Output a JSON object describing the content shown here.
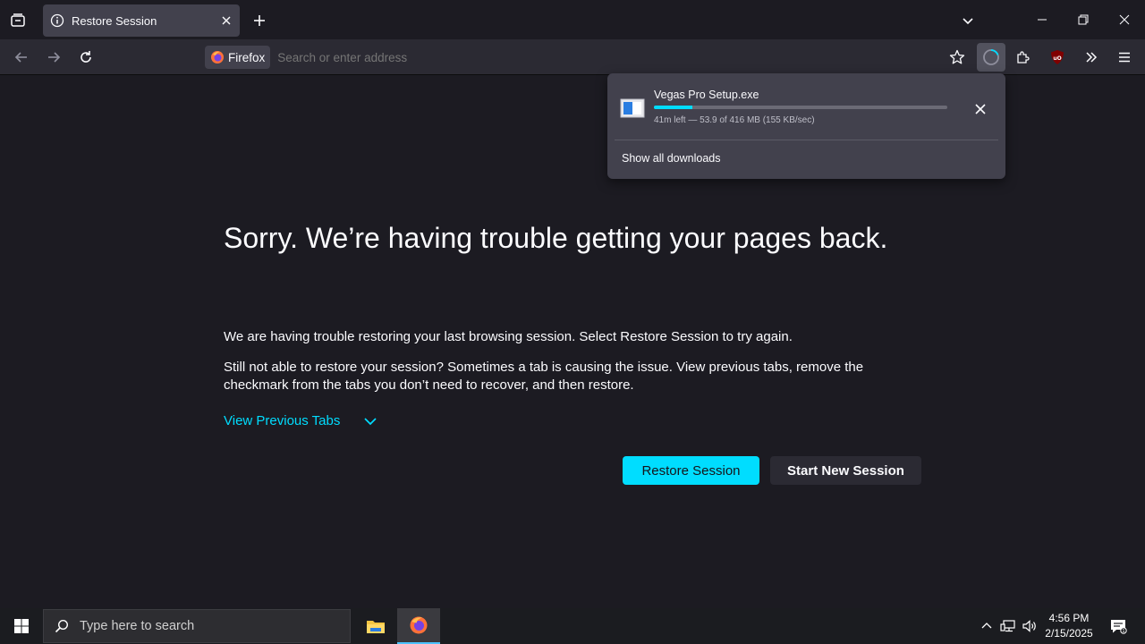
{
  "browser": {
    "tab": {
      "title": "Restore Session"
    },
    "identity_label": "Firefox",
    "url_placeholder": "Search or enter address"
  },
  "downloads": {
    "file_name": "Vegas Pro Setup.exe",
    "progress_fraction": 0.13,
    "status": "41m left — 53.9 of 416 MB (155 KB/sec)",
    "show_all": "Show all downloads"
  },
  "page": {
    "title": "Sorry. We’re having trouble getting your pages back.",
    "paragraph1": "We are having trouble restoring your last browsing session. Select Restore Session to try again.",
    "paragraph2": "Still not able to restore your session? Sometimes a tab is causing the issue. View previous tabs, remove the checkmark from the tabs you don’t need to recover, and then restore.",
    "view_previous_tabs": "View Previous Tabs",
    "restore_button": "Restore Session",
    "new_session_button": "Start New Session"
  },
  "taskbar": {
    "search_placeholder": "Type here to search",
    "time": "4:56 PM",
    "date": "2/15/2025"
  },
  "colors": {
    "accent": "#00ddff",
    "page_bg": "#1c1b22",
    "toolbar_bg": "#2b2a33",
    "panel_bg": "#42414d"
  }
}
